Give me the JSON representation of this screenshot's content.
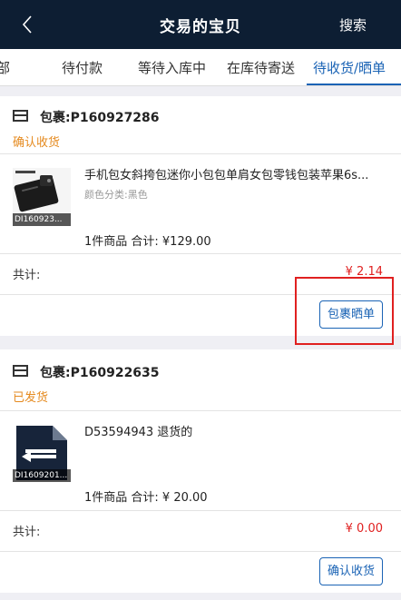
{
  "navbar": {
    "title": "交易的宝贝",
    "search_label": "搜索"
  },
  "tabs": [
    {
      "label": "部"
    },
    {
      "label": "待付款"
    },
    {
      "label": "等待入库中"
    },
    {
      "label": "在库待寄送"
    },
    {
      "label": "待收货/晒单",
      "active": true
    }
  ],
  "orders": [
    {
      "package_label": "包裹:P160927286",
      "status": "确认收货",
      "item": {
        "thumb_caption": "DI160923...",
        "title": "手机包女斜挎包迷你小包包单肩女包零钱包装苹果6s...",
        "spec": "颜色分类:黑色",
        "summary": "1件商品  合计: ¥129.00"
      },
      "total_label": "共计:",
      "total_value": "¥ 2.14",
      "action_label": "包裹晒单"
    },
    {
      "package_label": "包裹:P160922635",
      "status": "已发货",
      "item": {
        "thumb_caption": "DI1609201...",
        "title": "D53594943 退货的",
        "summary": "1件商品  合计: ¥ 20.00"
      },
      "total_label": "共计:",
      "total_value": "¥ 0.00",
      "action_label": "确认收货"
    }
  ],
  "colors": {
    "navbar": "#0d1e33",
    "accent": "#1a63b5",
    "status": "#e58a1f",
    "price": "#e02020"
  }
}
